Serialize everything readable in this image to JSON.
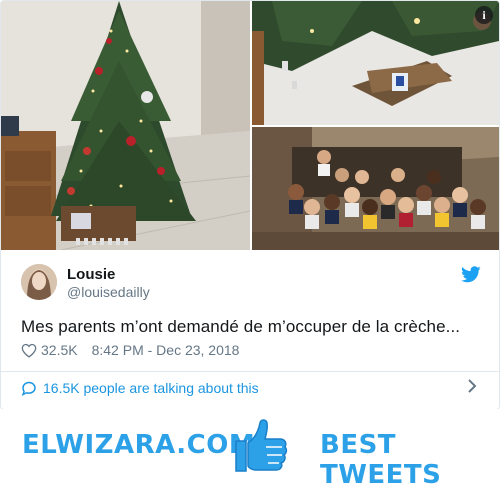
{
  "tweet": {
    "author_name": "Lousie",
    "author_handle": "@louisedailly",
    "text": "Mes parents m’ont demandé de m’occuper de la crèche...",
    "likes": "32.5K",
    "timestamp": "8:42 PM - Dec 23, 2018",
    "talking": "16.5K people are talking about this",
    "info_label": "i"
  },
  "banner": {
    "left_text": "ELWIZARA.COM",
    "right_text": "BEST TWEETS"
  },
  "colors": {
    "twitter_blue": "#1da1f2",
    "link_blue": "#1b95e0",
    "muted": "#657786",
    "brand_blue": "#2da1e8"
  },
  "icons": [
    "info-icon",
    "twitter-bird-icon",
    "heart-icon",
    "speech-bubble-icon",
    "chevron-right-icon",
    "thumbs-up-icon"
  ]
}
